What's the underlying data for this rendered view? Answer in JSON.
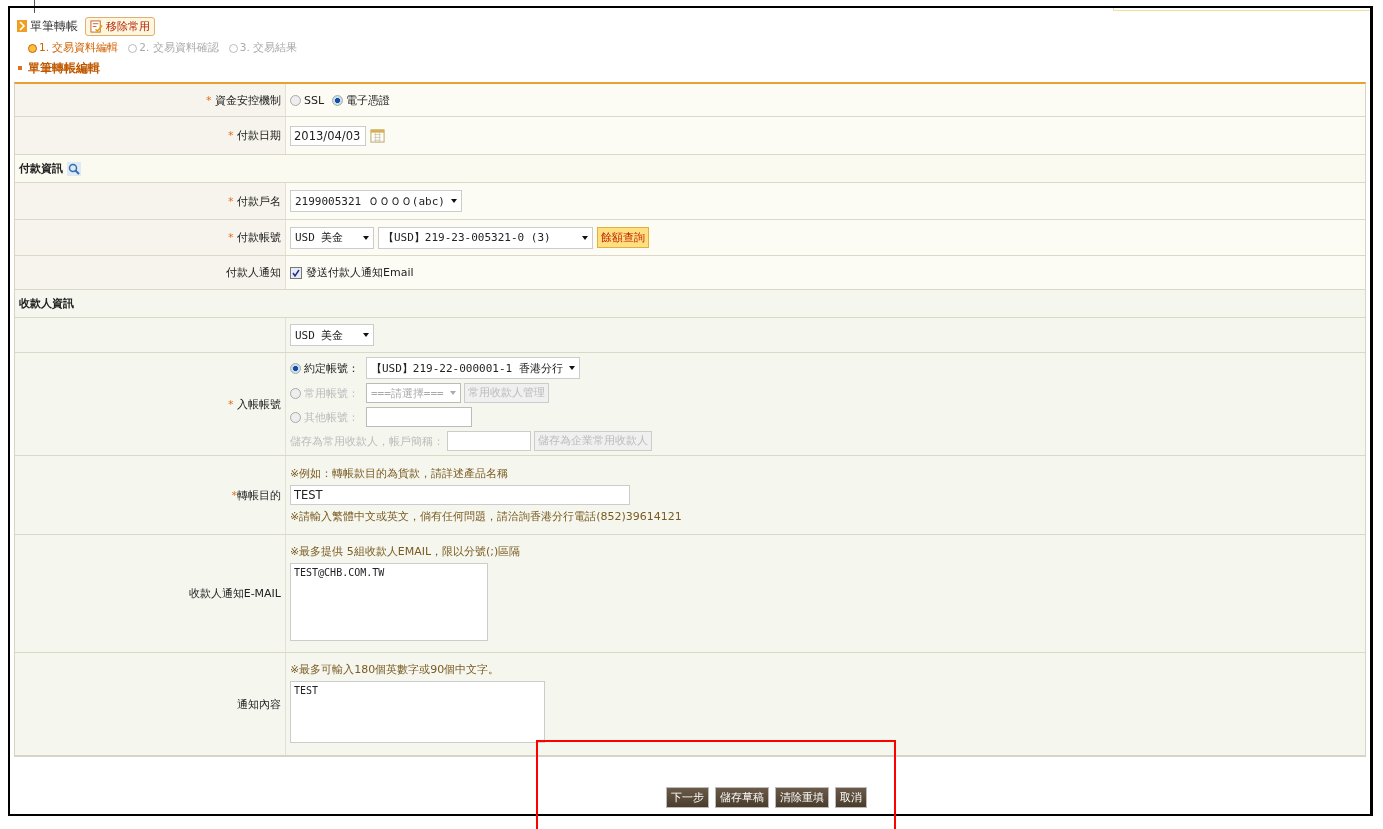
{
  "header": {
    "title": "單筆轉帳",
    "favorite_button": "移除常用"
  },
  "steps": [
    {
      "label": "1. 交易資料編輯",
      "selected": true
    },
    {
      "label": "2. 交易資料確認",
      "selected": false
    },
    {
      "label": "3. 交易結果",
      "selected": false
    }
  ],
  "section_title": "單筆轉帳編輯",
  "security": {
    "required_mark": "*",
    "label": "資金安控機制",
    "options": [
      {
        "label": "SSL",
        "selected": false
      },
      {
        "label": "電子憑證",
        "selected": true
      }
    ]
  },
  "payment_date": {
    "required_mark": "*",
    "label": "付款日期",
    "value": "2013/04/03"
  },
  "payer": {
    "title": "付款資訊",
    "name": {
      "required_mark": "*",
      "label": "付款戶名",
      "value": "2199005321 ＯＯＯＯ(abc)"
    },
    "account": {
      "required_mark": "*",
      "label": "付款帳號",
      "currency": "USD 美金",
      "account": "【USD】219-23-005321-0 (3)",
      "button": "餘額查詢"
    },
    "notify": {
      "label": "付款人通知",
      "checked": true,
      "text": "發送付款人通知Email"
    }
  },
  "payee": {
    "title": "收款人資訊",
    "currency": "USD 美金",
    "account": {
      "required_mark": "*",
      "label": "入帳帳號",
      "options": [
        {
          "kind": "select",
          "label": "約定帳號：",
          "selected": true,
          "disabled": false,
          "value": "【USD】219-22-000001-1 香港分行"
        },
        {
          "kind": "select",
          "label": "常用帳號：",
          "selected": false,
          "disabled": true,
          "value": "===請選擇===",
          "button": "常用收款人管理"
        },
        {
          "kind": "input",
          "label": "其他帳號：",
          "selected": false,
          "disabled": true
        }
      ],
      "save": {
        "label": "儲存為常用收款人，帳戶簡稱：",
        "button": "儲存為企業常用收款人",
        "disabled": true
      }
    },
    "purpose": {
      "required_mark": "*",
      "label": "轉帳目的",
      "hint": "※例如：轉帳款目的為貨款，請詳述產品名稱",
      "value": "TEST",
      "note": "※請輸入繁體中文或英文，倘有任何問題，請洽詢香港分行電話(852)39614121"
    },
    "email": {
      "label": "收款人通知E-MAIL",
      "hint": "※最多提供 5組收款人EMAIL，限以分號(;)區隔",
      "value": "TEST@CHB.COM.TW"
    },
    "content": {
      "label": "通知內容",
      "hint": "※最多可輸入180個英數字或90個中文字。",
      "value": "TEST"
    }
  },
  "buttons": [
    "下一步",
    "儲存草稿",
    "清除重填",
    "取消"
  ]
}
